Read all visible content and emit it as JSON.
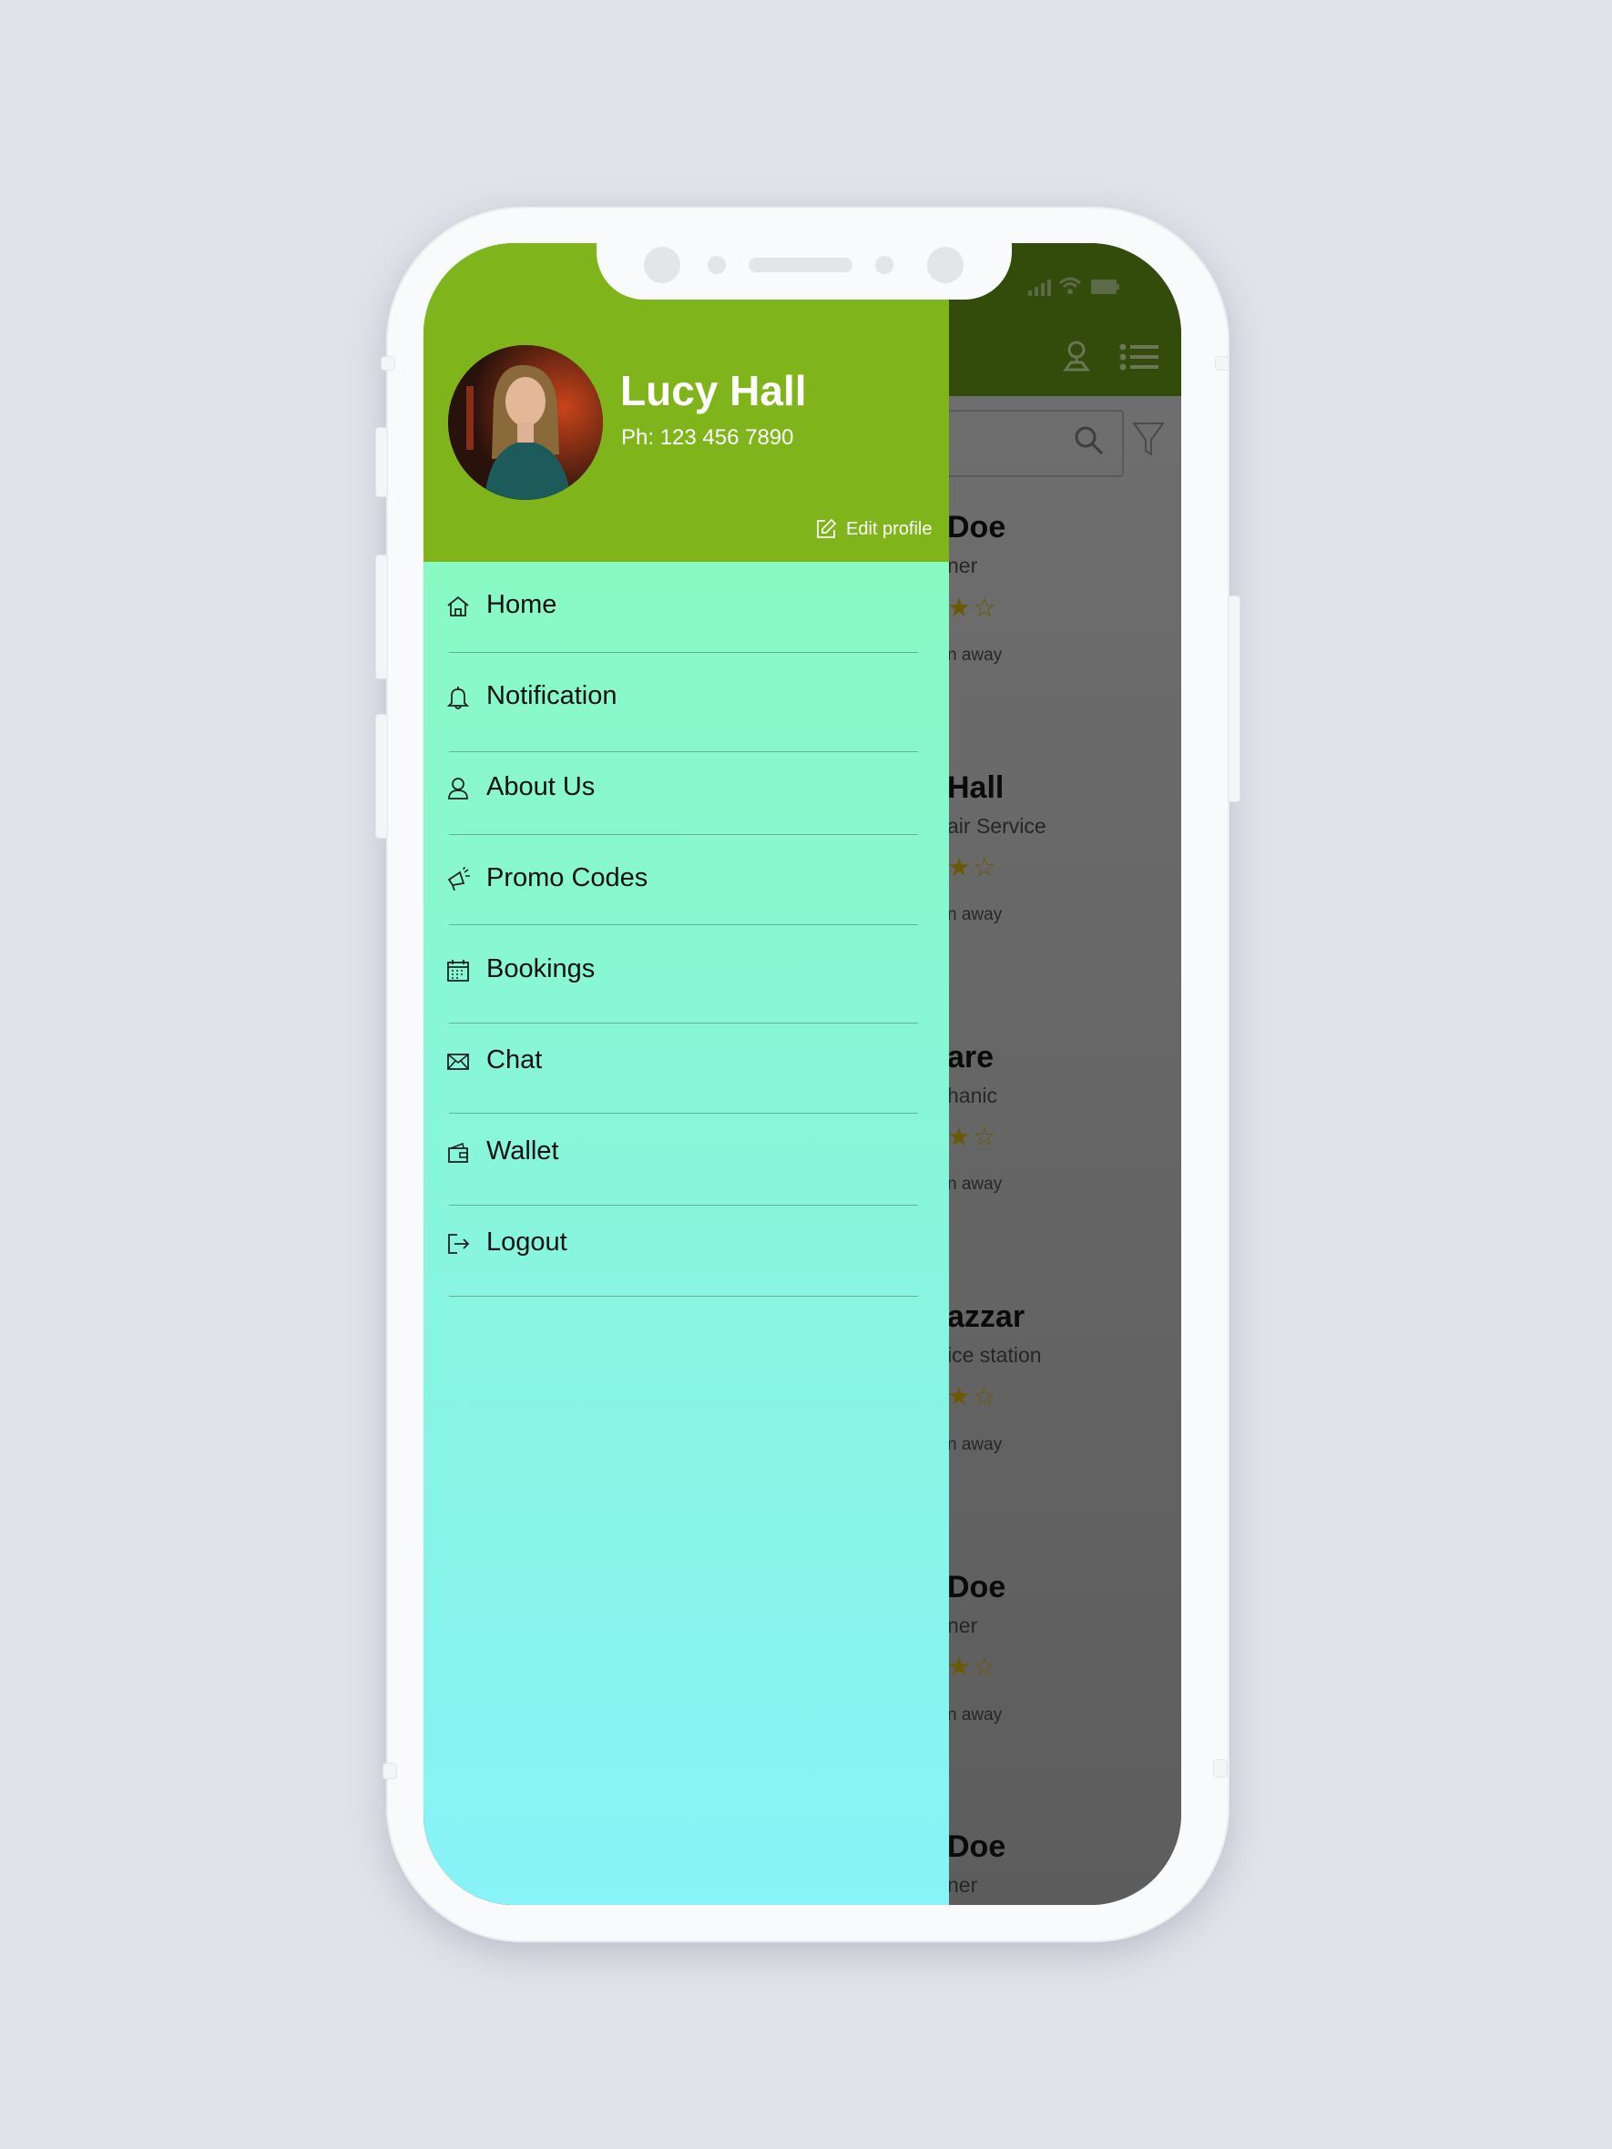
{
  "profile": {
    "name": "Lucy Hall",
    "phone": "Ph: 123 456 7890",
    "edit_label": "Edit profile"
  },
  "menu": [
    {
      "label": "Home",
      "icon": "home-icon"
    },
    {
      "label": "Notification",
      "icon": "bell-icon"
    },
    {
      "label": "About Us",
      "icon": "user-icon"
    },
    {
      "label": "Promo Codes",
      "icon": "megaphone-icon"
    },
    {
      "label": "Bookings",
      "icon": "calendar-icon"
    },
    {
      "label": "Chat",
      "icon": "mail-icon"
    },
    {
      "label": "Wallet",
      "icon": "wallet-icon"
    },
    {
      "label": "Logout",
      "icon": "logout-icon"
    }
  ],
  "background_list": [
    {
      "title": "Doe",
      "subtitle": "ner",
      "stars": "★☆",
      "distance": "n away"
    },
    {
      "title": "Hall",
      "subtitle": "air Service",
      "stars": "★☆",
      "distance": "n away"
    },
    {
      "title": "are",
      "subtitle": "hanic",
      "stars": "★☆",
      "distance": "n away"
    },
    {
      "title": "azzar",
      "subtitle": "ice station",
      "stars": "★☆",
      "distance": "n away"
    },
    {
      "title": "Doe",
      "subtitle": "ner",
      "stars": "★☆",
      "distance": "n away"
    },
    {
      "title": "Doe",
      "subtitle": "ner"
    }
  ],
  "colors": {
    "drawer_header": "#7fb51b",
    "drawer_gradient_top": "#89fbb7",
    "drawer_gradient_bottom": "#88f3f8",
    "background_header": "#334b0b"
  }
}
